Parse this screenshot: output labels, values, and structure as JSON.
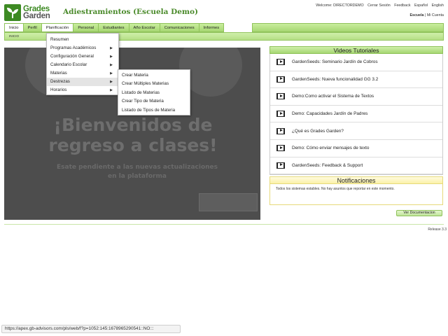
{
  "app": {
    "logo_line1": "Grades",
    "logo_line2": "Garden",
    "title": "Adiestramientos (Escuela Demo)",
    "brand_green": "#3d8a23"
  },
  "top_links": {
    "welcome": "Welcome: DIRECTORDEMO",
    "logout": "Cerrar Sesión",
    "feedback": "Feedback",
    "lang_es": "Español",
    "lang_en": "English"
  },
  "user_links": {
    "school": "Escuela",
    "account": "| Mi Cuenta"
  },
  "nav": {
    "items": [
      "Inicio",
      "Perfil",
      "Planificación",
      "Personal",
      "Estudiantes",
      "Año Escolar",
      "Comunicaciones",
      "Informes"
    ],
    "active": "Planificación"
  },
  "breadcrumb": "INICIO",
  "dropdown": {
    "items": [
      {
        "label": "Resumen",
        "arrow": ""
      },
      {
        "label": "Programas Académicos",
        "arrow": "▶"
      },
      {
        "label": "Configuración General",
        "arrow": "▶"
      },
      {
        "label": "Calendario Escolar",
        "arrow": "▶"
      },
      {
        "label": "Materias",
        "arrow": "▶"
      },
      {
        "label": "Destrezas",
        "arrow": "▶"
      },
      {
        "label": "Horarios",
        "arrow": "▶"
      }
    ],
    "highlighted": "Destrezas"
  },
  "submenu": {
    "items": [
      "Crear Materia",
      "Crear Múltiples Materias",
      "Listado de Materias",
      "Crear Tipo de Materia",
      "Listado de Tipos de Materia"
    ]
  },
  "banner": {
    "title": "¡Bienvenidos de regreso a clases!",
    "subtitle": "Esate pendiente a las nuevas actualizaciones en la plataforma"
  },
  "videos": {
    "header": "Videos Tutoriales",
    "items": [
      "GardenSeeds: Seminario Jardín de Cobros",
      "GardenSeeds: Nueva funcionalidad GG 3.2",
      "Demo:Como activar el Sistema de Textos",
      "Demo: Capacidades Jardín de Padres",
      "¿Qué es Grades Garden?",
      "Demo: Cómo enviar mensajes de texto",
      "GardenSeeds: Feedback & Support"
    ]
  },
  "notifications": {
    "header": "Notificaciones",
    "message": "Todos los sistemas estables. No hay asuntos que reportar en este momento."
  },
  "doc_button": "Ver Documentacion",
  "release": "Release 3.3",
  "status_url": "https://apex.gb-advisors.com/pls/web/f?p=1052:145:1678965290541::NO:::"
}
